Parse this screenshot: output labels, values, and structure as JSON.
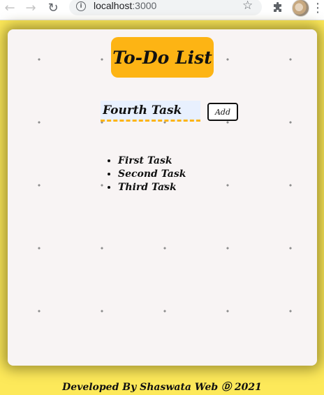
{
  "browser": {
    "url_host": "localhost",
    "url_port": ":3000",
    "icons": {
      "back": "back-arrow-icon",
      "forward": "forward-arrow-icon",
      "reload": "reload-icon",
      "info": "info-icon",
      "star": "star-icon",
      "extensions": "puzzle-icon",
      "menu": "more-vert-icon"
    }
  },
  "app": {
    "title": "To-Do List",
    "input_value": "Fourth Task",
    "add_label": "Add",
    "tasks": [
      "First Task",
      "Second Task",
      "Third Task"
    ],
    "footer": "Developed By Shaswata Web Ⓓ 2021"
  },
  "colors": {
    "page_background": "#fde95a",
    "card_background": "#f8f4f4",
    "accent": "#fdb414",
    "input_background": "#e8f0fe"
  }
}
